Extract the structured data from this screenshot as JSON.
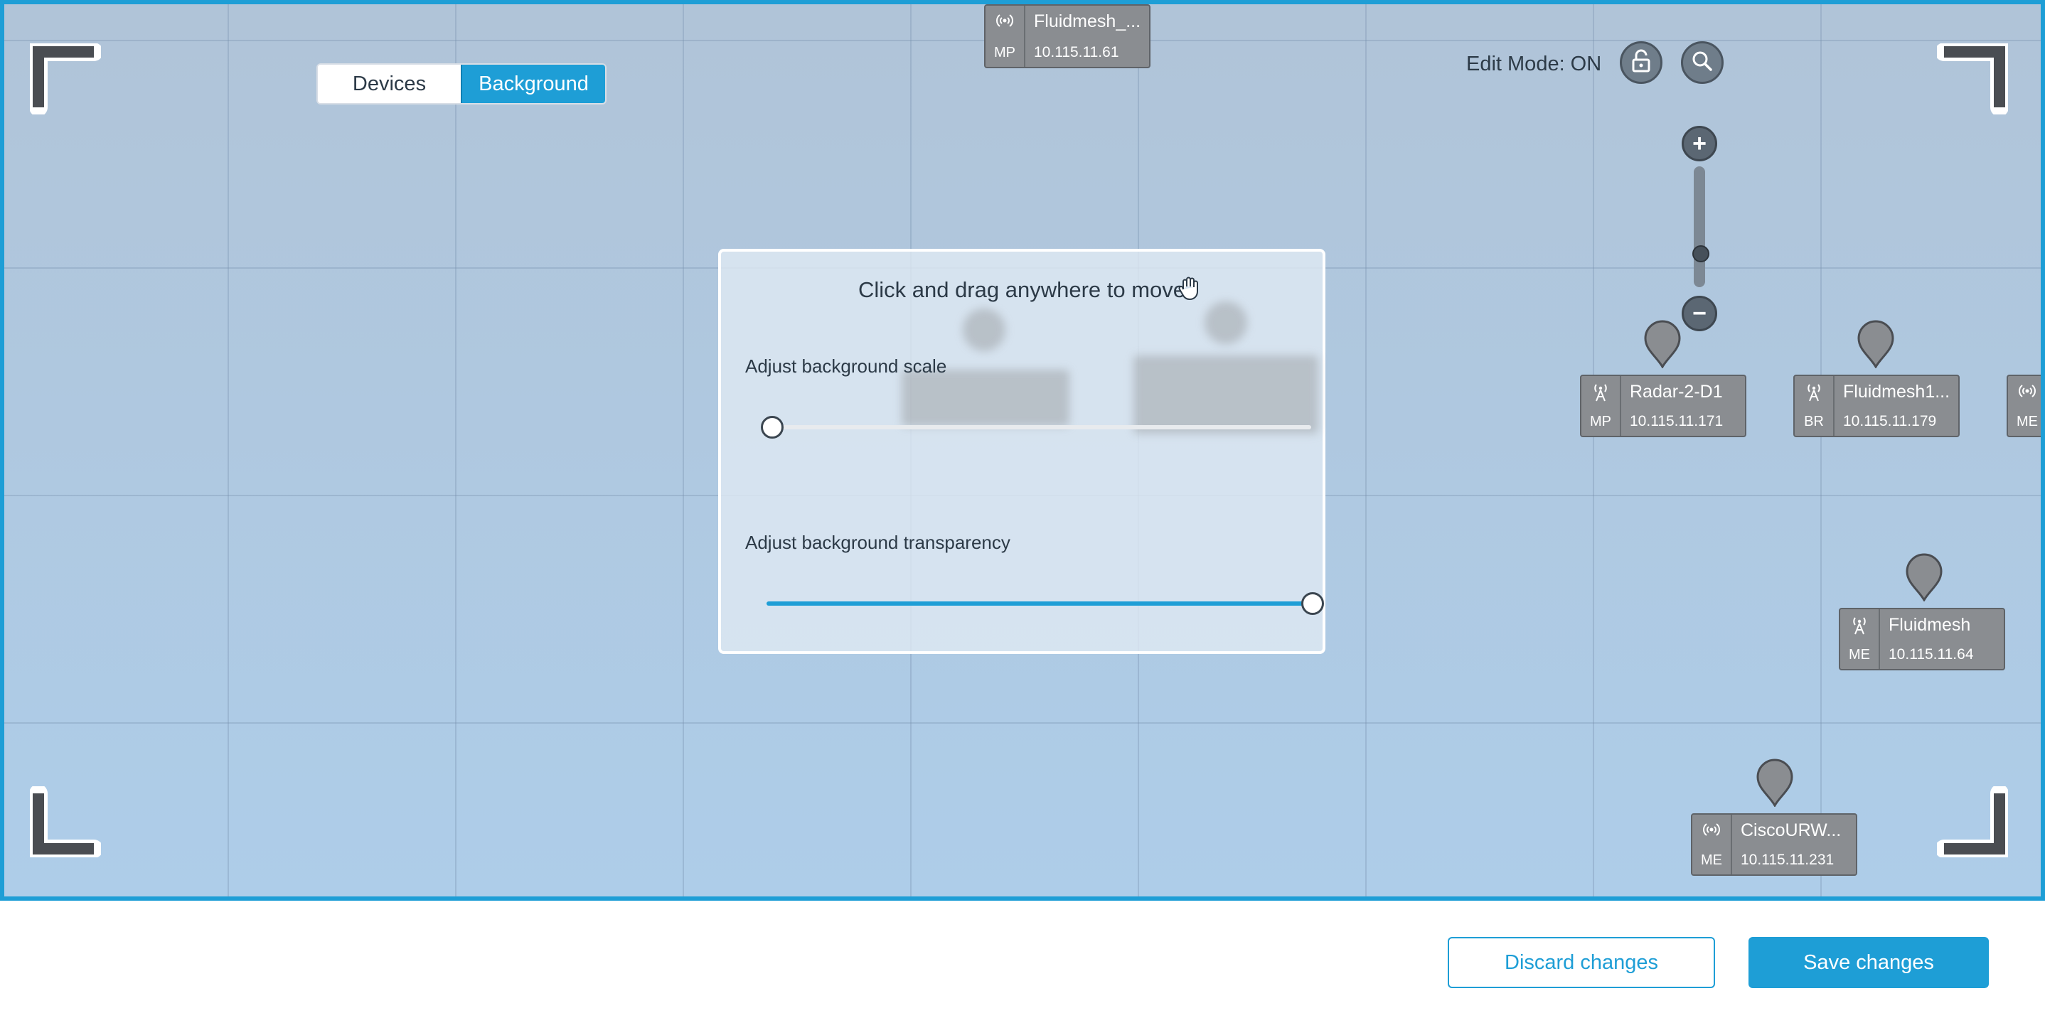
{
  "toggle": {
    "devices_label": "Devices",
    "background_label": "Background",
    "active": "Background"
  },
  "edit_mode": {
    "label": "Edit Mode: ON"
  },
  "zoom": {
    "plus": "+",
    "minus": "−",
    "level": 0.35
  },
  "devices": [
    {
      "name": "Fluidmesh_...",
      "role": "MP",
      "ip": "10.115.11.61"
    },
    {
      "name": "Radar-2-D1",
      "role": "MP",
      "ip": "10.115.11.171"
    },
    {
      "name": "Fluidmesh1...",
      "role": "BR",
      "ip": "10.115.11.179"
    },
    {
      "name": "",
      "role": "ME",
      "ip": ""
    },
    {
      "name": "Fluidmesh",
      "role": "ME",
      "ip": "10.115.11.64"
    },
    {
      "name": "CiscoURW...",
      "role": "ME",
      "ip": "10.115.11.231"
    }
  ],
  "panel": {
    "title": "Click and drag anywhere to move",
    "scale_label": "Adjust background scale",
    "scale_value": 0.0,
    "transparency_label": "Adjust background transparency",
    "transparency_value": 1.0
  },
  "footer": {
    "discard_label": "Discard changes",
    "save_label": "Save changes"
  },
  "colors": {
    "accent": "#1e9ed6",
    "card": "#8a8d91",
    "map": "#b1c6dc"
  }
}
